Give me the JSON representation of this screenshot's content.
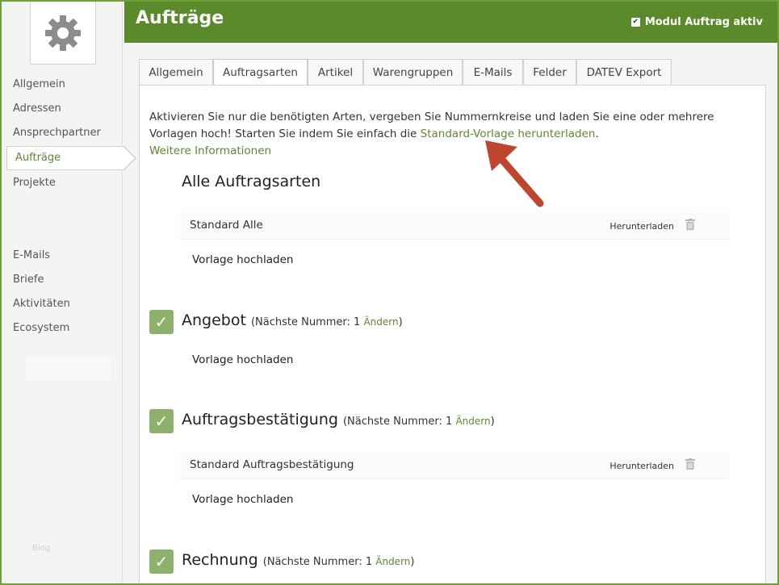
{
  "header": {
    "title": "Aufträge",
    "module_toggle_label": "Modul Auftrag aktiv",
    "module_active": true
  },
  "sidebar": {
    "items": [
      {
        "label": "Allgemein"
      },
      {
        "label": "Adressen"
      },
      {
        "label": "Ansprechpartner"
      },
      {
        "label": "Aufträge",
        "active": true
      },
      {
        "label": "Projekte"
      },
      {
        "label": "E-Mails"
      },
      {
        "label": "Briefe"
      },
      {
        "label": "Aktivitäten"
      },
      {
        "label": "Ecosystem"
      }
    ],
    "footer_link": "Blog"
  },
  "tabs": [
    {
      "label": "Allgemein"
    },
    {
      "label": "Auftragsarten",
      "active": true
    },
    {
      "label": "Artikel"
    },
    {
      "label": "Warengruppen"
    },
    {
      "label": "E-Mails"
    },
    {
      "label": "Felder"
    },
    {
      "label": "DATEV Export"
    }
  ],
  "intro": {
    "text1": "Aktivieren Sie nur die benötigten Arten, vergeben Sie Nummernkreise und laden Sie eine oder mehrere Vorlagen hoch! Starten Sie indem Sie einfach die ",
    "template_link": "Standard-Vorlage herunterladen",
    "text2": ".",
    "more_info": "Weitere Informationen"
  },
  "sections": {
    "all": {
      "title": "Alle Auftragsarten",
      "template_name": "Standard Alle",
      "download": "Herunterladen",
      "upload": "Vorlage hochladen"
    },
    "angebot": {
      "title": "Angebot",
      "next_prefix": "(Nächste Nummer: 1 ",
      "change": "Ändern",
      "next_suffix": ")",
      "upload": "Vorlage hochladen",
      "checked": true
    },
    "bestaetigung": {
      "title": "Auftragsbestätigung",
      "next_prefix": "(Nächste Nummer: 1 ",
      "change": "Ändern",
      "next_suffix": ")",
      "template_name": "Standard Auftragsbestätigung",
      "download": "Herunterladen",
      "upload": "Vorlage hochladen",
      "checked": true
    },
    "rechnung": {
      "title": "Rechnung",
      "next_prefix": "(Nächste Nummer: 1 ",
      "change": "Ändern",
      "next_suffix": ")",
      "checked": true
    }
  },
  "icons": {
    "logo": "gear-icon",
    "check": "check-icon",
    "trash": "trash-icon",
    "annotation": "arrow-annotation"
  },
  "colors": {
    "header": "#5a8a2a",
    "frame": "#6fa03a",
    "link": "#5c8a2e",
    "check": "#8db06a",
    "arrow": "#c0452e"
  }
}
